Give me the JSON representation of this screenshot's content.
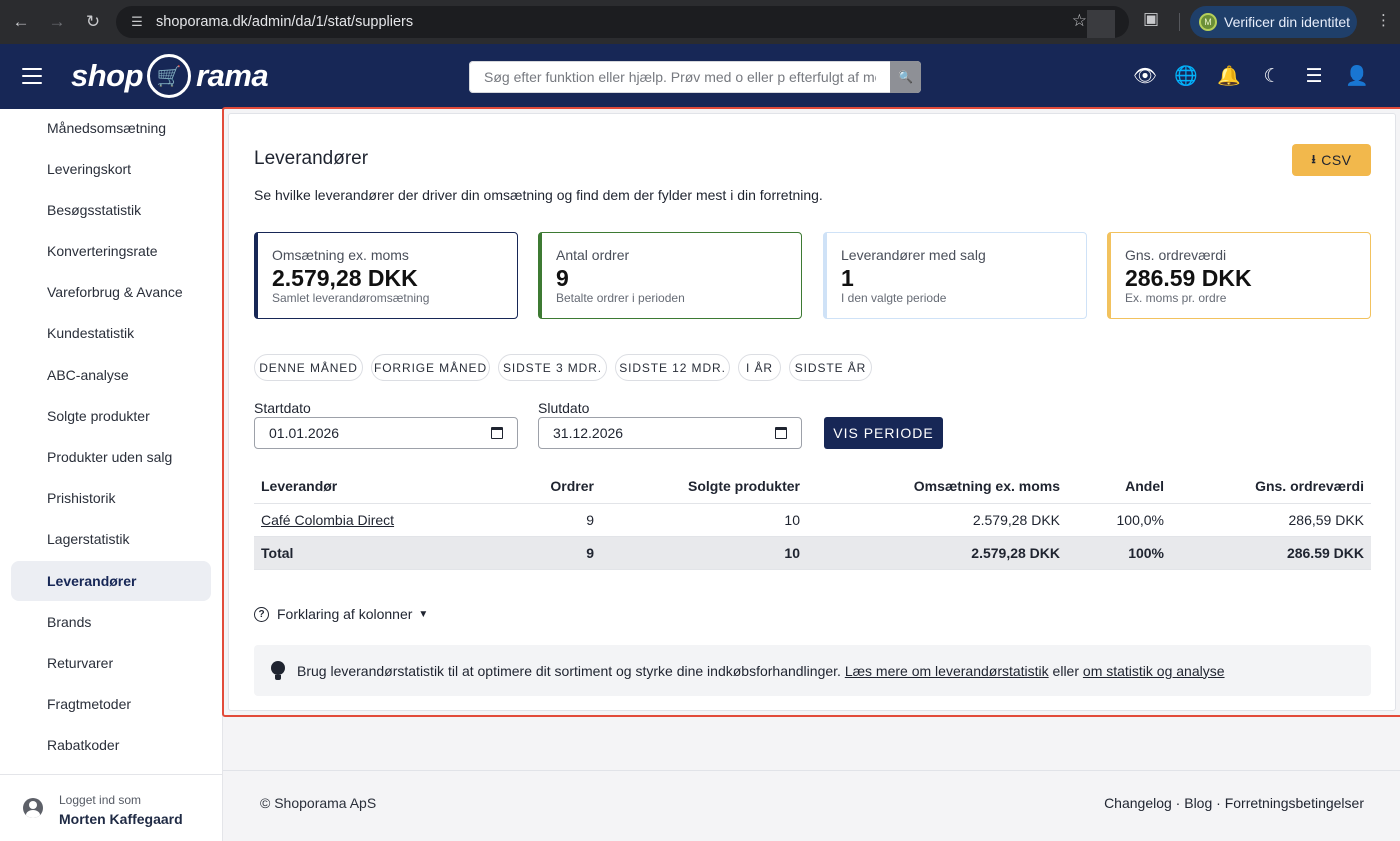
{
  "browser": {
    "url": "shoporama.dk/admin/da/1/stat/suppliers",
    "verify_label": "Verificer din identitet",
    "verify_badge": "M"
  },
  "header": {
    "logo_left": "shop",
    "logo_right": "rama",
    "search_placeholder": "Søg efter funktion eller hjælp. Prøv med o eller p efterfulgt af mellemrum"
  },
  "sidebar": {
    "items": [
      {
        "label": "Månedsomsætning"
      },
      {
        "label": "Leveringskort"
      },
      {
        "label": "Besøgsstatistik"
      },
      {
        "label": "Konverteringsrate"
      },
      {
        "label": "Vareforbrug & Avance"
      },
      {
        "label": "Kundestatistik"
      },
      {
        "label": "ABC-analyse"
      },
      {
        "label": "Solgte produkter"
      },
      {
        "label": "Produkter uden salg"
      },
      {
        "label": "Prishistorik"
      },
      {
        "label": "Lagerstatistik"
      },
      {
        "label": "Leverandører"
      },
      {
        "label": "Brands"
      },
      {
        "label": "Returvarer"
      },
      {
        "label": "Fragtmetoder"
      },
      {
        "label": "Rabatkoder"
      }
    ],
    "active_label": "Leverandører",
    "user": {
      "logged_in_label": "Logget ind som",
      "name": "Morten Kaffegaard"
    }
  },
  "main": {
    "title": "Leverandører",
    "csv_label": "CSV",
    "subtitle": "Se hvilke leverandører der driver din omsætning og find dem der fylder mest i din forretning.",
    "kpis": [
      {
        "label": "Omsætning ex. moms",
        "value": "2.579,28 DKK",
        "sub": "Samlet leverandøromsætning",
        "color": "#172756"
      },
      {
        "label": "Antal ordrer",
        "value": "9",
        "sub": "Betalte ordrer i perioden",
        "color": "#3d7a33"
      },
      {
        "label": "Leverandører med salg",
        "value": "1",
        "sub": "I den valgte periode",
        "color": "#cfe2f7"
      },
      {
        "label": "Gns. ordreværdi",
        "value": "286.59 DKK",
        "sub": "Ex. moms pr. ordre",
        "color": "#f2c25e"
      }
    ],
    "period_chips": [
      "DENNE MÅNED",
      "FORRIGE MÅNED",
      "SIDSTE 3 MDR.",
      "SIDSTE 12 MDR.",
      "I ÅR",
      "SIDSTE ÅR"
    ],
    "start_label": "Startdato",
    "start_value": "01.01.2026",
    "end_label": "Slutdato",
    "end_value": "31.12.2026",
    "show_period_label": "VIS PERIODE",
    "table": {
      "headers": [
        "Leverandør",
        "Ordrer",
        "Solgte produkter",
        "Omsætning ex. moms",
        "Andel",
        "Gns. ordreværdi"
      ],
      "rows": [
        [
          "Café Colombia Direct",
          "9",
          "10",
          "2.579,28 DKK",
          "100,0%",
          "286,59 DKK"
        ]
      ],
      "total": [
        "Total",
        "9",
        "10",
        "2.579,28 DKK",
        "100%",
        "286.59 DKK"
      ]
    },
    "explain_label": "Forklaring af kolonner",
    "tip": {
      "text": "Brug leverandørstatistik til at optimere dit sortiment og styrke dine indkøbsforhandlinger.",
      "link1": "Læs mere om leverandørstatistik",
      "between": "eller",
      "link2": "om statistik og analyse"
    }
  },
  "footer": {
    "copyright": "© Shoporama ApS",
    "links": "Changelog · Blog · Forretningsbetingelser"
  }
}
